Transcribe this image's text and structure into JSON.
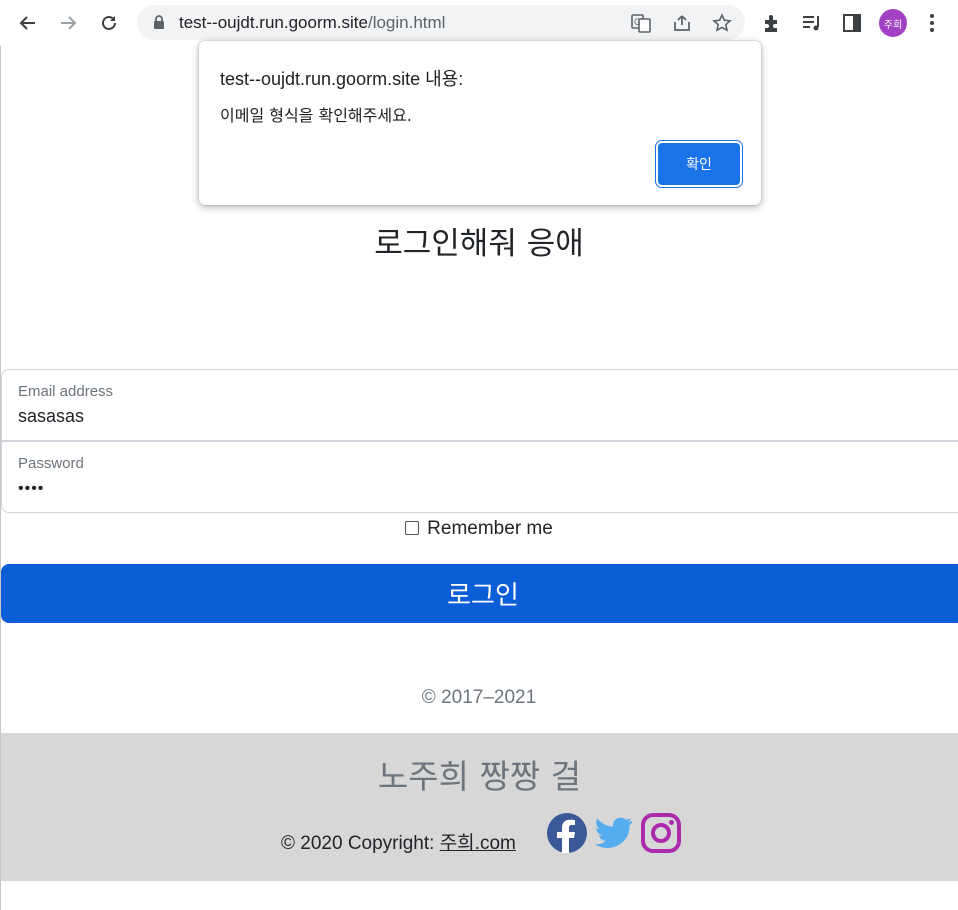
{
  "browser": {
    "url_host": "test--oujdt.run.goorm.site",
    "url_path": "/login.html",
    "profile_initials": "주희",
    "icons": [
      "back-icon",
      "forward-icon",
      "reload-icon",
      "lock-icon",
      "translate-icon",
      "share-icon",
      "star-icon",
      "extensions-icon",
      "media-icon",
      "sidepanel-icon",
      "menu-icon"
    ]
  },
  "dialog": {
    "title": "test--oujdt.run.goorm.site 내용:",
    "message": "이메일 형식을 확인해주세요.",
    "ok_label": "확인"
  },
  "page": {
    "title": "로그인해줘 응애",
    "email": {
      "label": "Email address",
      "value": "sasasas"
    },
    "password": {
      "label": "Password",
      "value": "••••"
    },
    "remember_label": "Remember me",
    "login_label": "로그인",
    "copyright_years": "© 2017–2021"
  },
  "footer": {
    "title": "노주희 짱짱 걸",
    "copyright_prefix": "© 2020 Copyright: ",
    "copyright_link": "주희.com",
    "colors": {
      "facebook": "#3b5998",
      "twitter": "#55acee",
      "instagram": "#ac2bac"
    }
  }
}
